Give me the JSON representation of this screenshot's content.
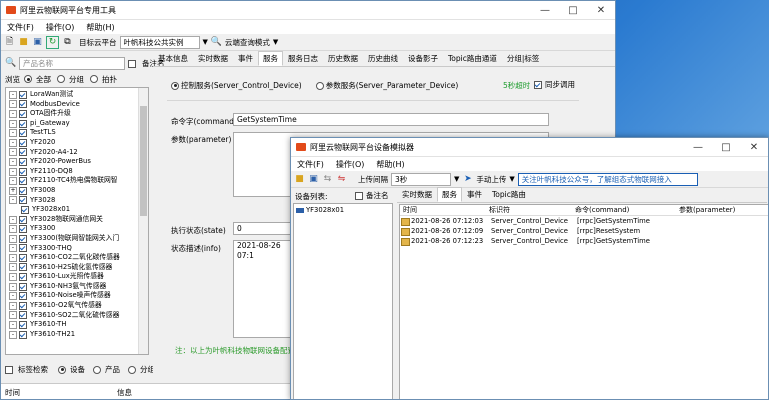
{
  "main": {
    "title": "阿里云物联网平台专用工具",
    "menu": [
      "文件(F)",
      "操作(O)",
      "帮助(H)"
    ],
    "platform_label": "目标云平台",
    "platform_value": "叶帆科技公共实例",
    "cloud_mode": "云端查询模式",
    "browse_label": "浏览",
    "filter_options": [
      "全部",
      "分组",
      "拍扑"
    ],
    "search_placeholder": "产品名称",
    "note_label": "备注名",
    "tree_items": [
      {
        "label": "LoraWan测试",
        "expander": "-"
      },
      {
        "label": "ModbusDevice",
        "expander": "-"
      },
      {
        "label": "OTA固件升级",
        "expander": "-"
      },
      {
        "label": "pi_Gateway",
        "expander": "-"
      },
      {
        "label": "TestTLS",
        "expander": "-"
      },
      {
        "label": "YF2020",
        "expander": "-"
      },
      {
        "label": "YF2020-A4-12",
        "expander": "-"
      },
      {
        "label": "YF2020-PowerBus",
        "expander": "-"
      },
      {
        "label": "YF2110-DQ8",
        "expander": "-"
      },
      {
        "label": "YF2110-TC4热电偶物联网智",
        "expander": "-"
      },
      {
        "label": "YF3008",
        "expander": "+"
      },
      {
        "label": "YF3028",
        "expander": "-"
      },
      {
        "label": "YF3028x01",
        "expander": "",
        "child": true
      },
      {
        "label": "YF3028物联网通信网关",
        "expander": "-"
      },
      {
        "label": "YF3300",
        "expander": "-"
      },
      {
        "label": "YF3300(物联网智能网关入门",
        "expander": "-"
      },
      {
        "label": "YF3300-THQ",
        "expander": "-"
      },
      {
        "label": "YF3610-CO2二氧化碳传感器",
        "expander": "-"
      },
      {
        "label": "YF3610-H2S硫化氢传感器",
        "expander": "-"
      },
      {
        "label": "YF3610-Lux光照传感器",
        "expander": "-"
      },
      {
        "label": "YF3610-NH3氨气传感器",
        "expander": "-"
      },
      {
        "label": "YF3610-Noise噪声传感器",
        "expander": "-"
      },
      {
        "label": "YF3610-O2氧气传感器",
        "expander": "-"
      },
      {
        "label": "YF3610-SO2二氧化硫传感器",
        "expander": "-"
      },
      {
        "label": "YF3610-TH",
        "expander": "-"
      },
      {
        "label": "YF3610-TH21",
        "expander": "-"
      }
    ],
    "bottom_filter": {
      "label": "标签检索",
      "options": [
        "设备",
        "产品",
        "分组"
      ]
    },
    "log_headers": {
      "time": "时间",
      "info": "信息"
    },
    "tabs": [
      "基本信息",
      "实时数据",
      "事件",
      "服务",
      "服务日志",
      "历史数据",
      "历史曲线",
      "设备影子",
      "Topic路由通道",
      "分组|标签"
    ],
    "service": {
      "radio_control": "控制服务(Server_Control_Device)",
      "radio_param": "参数服务(Server_Parameter_Device)",
      "timeout": "5秒超时",
      "sync": "同步调用",
      "command_label": "命令字(command)",
      "command_value": "GetSystemTime",
      "param_label": "参数(parameter)",
      "exec_label": "执行状态(state)",
      "exec_value": "0",
      "desc_label": "状态描述(info)",
      "desc_value": "2021-08-26 07:1",
      "note": "注：以上为叶帆科技物联网设备配置"
    }
  },
  "sim": {
    "title": "阿里云物联网平台设备模拟器",
    "menu": [
      "文件(F)",
      "操作(O)",
      "帮助(H)"
    ],
    "interval_label": "上传间隔",
    "interval_value": "3秒",
    "manual_upload": "手动上传",
    "promo": "关注叶帆科技公众号，了解组态式物联网接入",
    "device_list_label": "设备列表:",
    "note_label": "备注名",
    "device": "YF3028x01",
    "tabs": [
      "实时数据",
      "服务",
      "事件",
      "Topic路由"
    ],
    "columns": [
      "时间",
      "标识符",
      "命令(command)",
      "参数(parameter)"
    ],
    "rows": [
      {
        "time": "2021-08-26 07:12:03",
        "id": "Server_Control_Device",
        "cmd": "[rrpc]GetSystemTime",
        "param": ""
      },
      {
        "time": "2021-08-26 07:12:09",
        "id": "Server_Control_Device",
        "cmd": "[rrpc]ResetSystem",
        "param": ""
      },
      {
        "time": "2021-08-26 07:12:23",
        "id": "Server_Control_Device",
        "cmd": "[rrpc]GetSystemTime",
        "param": ""
      }
    ]
  },
  "colors": {
    "accent": "#1a5fb4",
    "timeout": "#1e9c2e",
    "note": "#2a9a2a",
    "titlebar_icon": "#e24a1a"
  }
}
